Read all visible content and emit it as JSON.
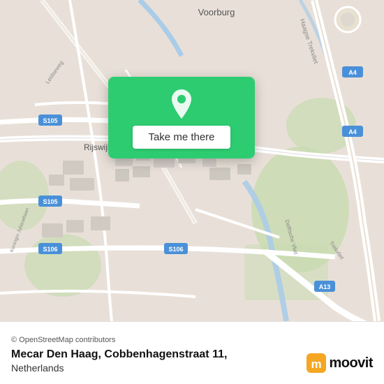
{
  "map": {
    "background_color": "#e8e0d8",
    "center_lat": 52.0405,
    "center_lon": 4.3683
  },
  "popup": {
    "button_label": "Take me there",
    "background_color": "#2ecc71"
  },
  "footer": {
    "copyright": "© OpenStreetMap contributors",
    "location_name": "Mecar Den Haag, Cobbenhagenstraat 11,",
    "country": "Netherlands"
  },
  "moovit": {
    "brand": "moovit"
  }
}
